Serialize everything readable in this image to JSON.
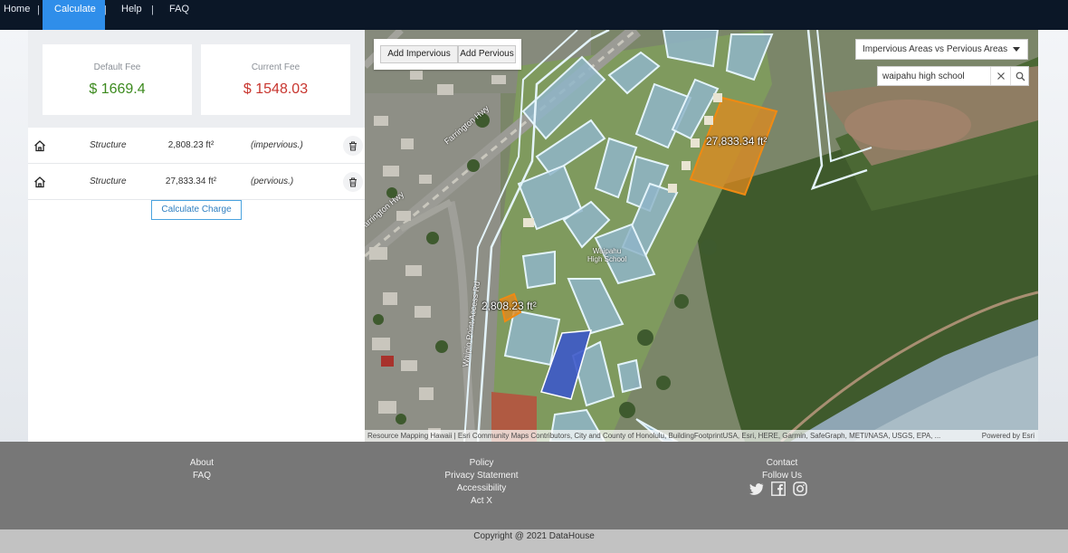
{
  "nav": {
    "home": "Home",
    "calculate": "Calculate",
    "help": "Help",
    "faq": "FAQ",
    "separator": "|"
  },
  "fees": {
    "default_label": "Default Fee",
    "default_value": "$ 1669.4",
    "current_label": "Current Fee",
    "current_value": "$ 1548.03"
  },
  "structures": [
    {
      "type": "Structure",
      "area": "2,808.23 ft²",
      "kind": "(impervious.)"
    },
    {
      "type": "Structure",
      "area": "27,833.34 ft²",
      "kind": "(pervious.)"
    }
  ],
  "calculate_button": "Calculate Charge",
  "map": {
    "add_impervious": "Add Impervious",
    "add_pervious": "Add Pervious",
    "layer_select": "Impervious Areas vs Pervious Areas",
    "search_value": "waipahu high school",
    "label_large": "27,833.34 ft²",
    "label_small": "2,808.23 ft²",
    "school_line1": "Waipahu",
    "school_line2": "High School",
    "road_farrington_1": "Farrington Hwy",
    "road_farrington_2": "Farrington Hwy",
    "road_waipio": "Waipio Point Access Rd",
    "attribution": "Resource Mapping Hawaii | Esri Community Maps Contributors, City and County of Honolulu, BuildingFootprintUSA, Esri, HERE, Garmin, SafeGraph, METI/NASA, USGS, EPA, ...",
    "powered_by": "Powered by Esri"
  },
  "footer": {
    "about": "About",
    "faq": "FAQ",
    "policy": "Policy",
    "privacy": "Privacy Statement",
    "accessibility": "Accessibility",
    "actx": "Act X",
    "contact": "Contact",
    "follow": "Follow Us",
    "copyright": "Copyright @ 2021 DataHouse"
  },
  "colors": {
    "nav_bg": "#0b1727",
    "nav_active": "#2f8eea",
    "fee_default": "#3c8a1e",
    "fee_current": "#c8362f",
    "impervious_outline": "#bfe3f5",
    "pervious_fill": "#e08a1e",
    "footer_bg": "#777777"
  },
  "icons": [
    "home-icon",
    "trash-icon",
    "close-icon",
    "search-icon",
    "caret-down-icon",
    "twitter-icon",
    "facebook-icon",
    "instagram-icon"
  ]
}
